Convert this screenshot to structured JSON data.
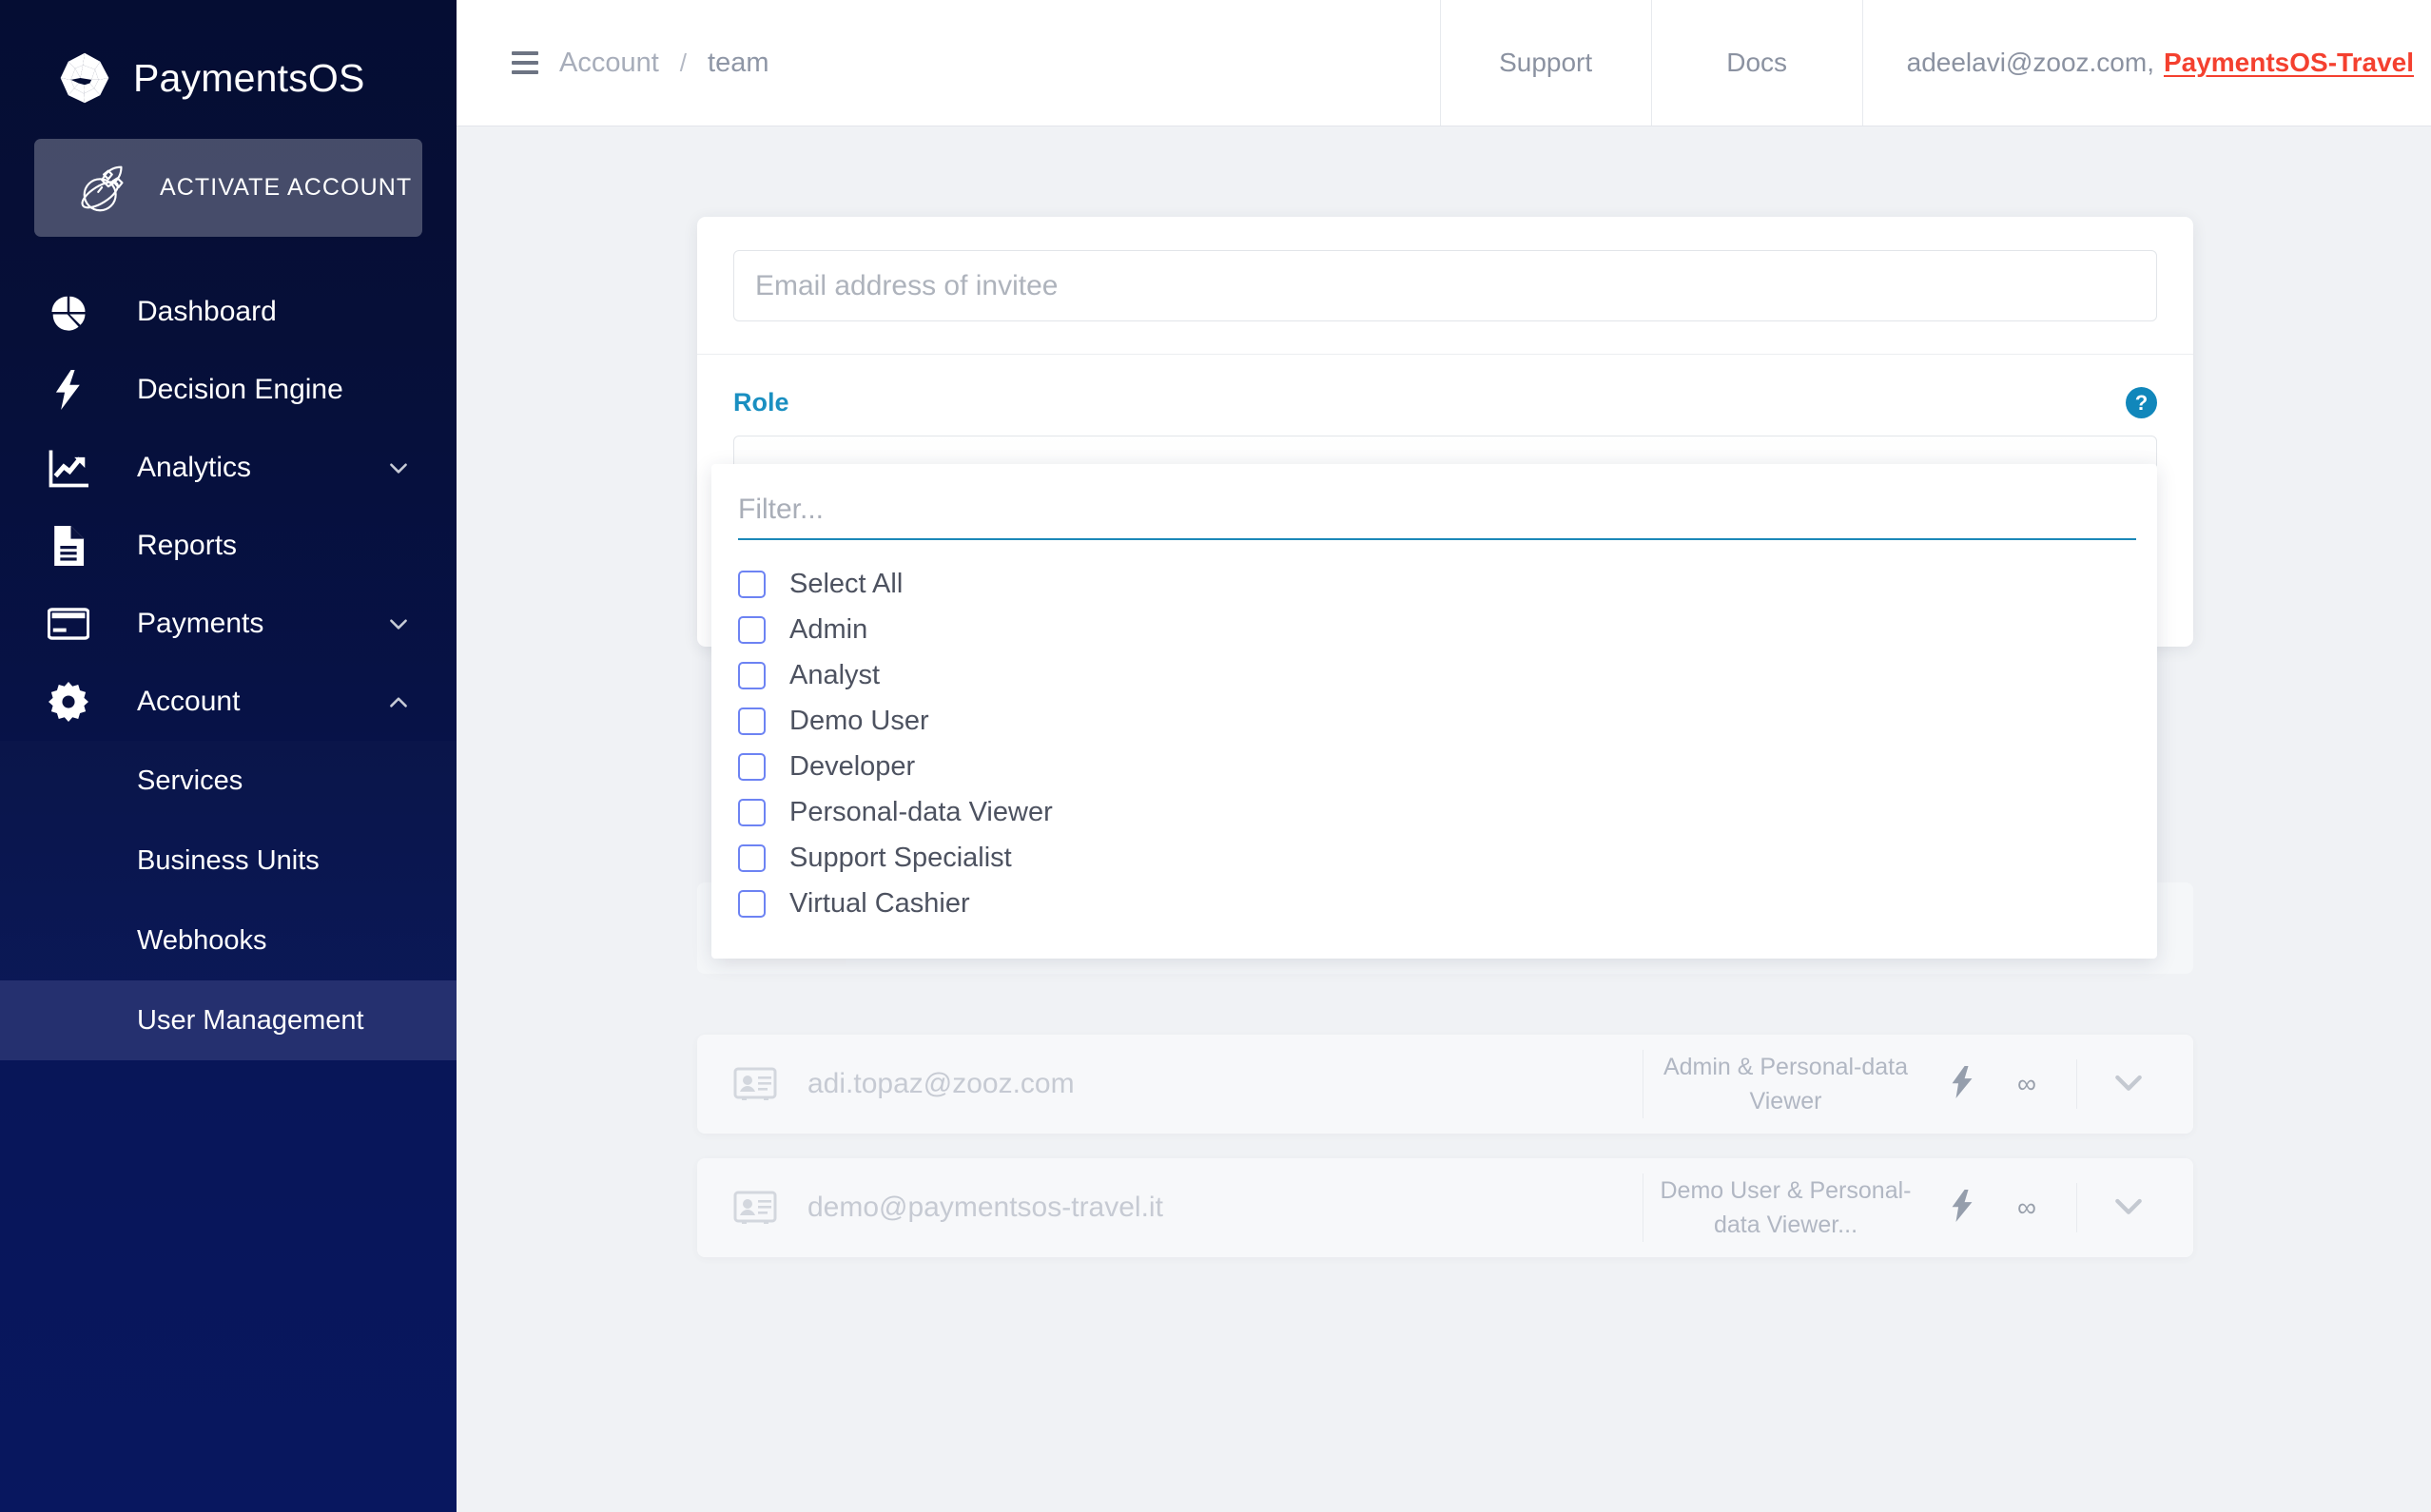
{
  "sidebar": {
    "brand": {
      "name": "PaymentsOS",
      "logo_icon": "paymentsos-polygon-logo"
    },
    "activate": {
      "label": "ACTIVATE ACCOUNT",
      "icon": "rocket-planet-icon"
    },
    "items": [
      {
        "label": "Dashboard",
        "icon": "pie-chart-icon",
        "chevron": ""
      },
      {
        "label": "Decision Engine",
        "icon": "lightning-bolt-icon",
        "chevron": ""
      },
      {
        "label": "Analytics",
        "icon": "trend-chart-icon",
        "chevron": "down"
      },
      {
        "label": "Reports",
        "icon": "document-icon",
        "chevron": ""
      },
      {
        "label": "Payments",
        "icon": "credit-card-icon",
        "chevron": "down"
      },
      {
        "label": "Account",
        "icon": "gear-icon",
        "chevron": "up"
      }
    ],
    "sub_items": [
      {
        "label": "Services",
        "active": false
      },
      {
        "label": "Business Units",
        "active": false
      },
      {
        "label": "Webhooks",
        "active": false
      },
      {
        "label": "User Management",
        "active": true
      }
    ]
  },
  "header": {
    "menu_icon": "hamburger-icon",
    "breadcrumb": {
      "parent": "Account",
      "separator": "/",
      "current": "team"
    },
    "support_label": "Support",
    "docs_label": "Docs",
    "user_email": "adeelavi@zooz.com,",
    "organization": "PaymentsOS-Travel",
    "organization_color": "#f4402f"
  },
  "invite_form": {
    "email_placeholder": "Email address of invitee",
    "email_value": "",
    "role_label": "Role",
    "help_icon": "question-mark-icon",
    "help_glyph": "?",
    "role_value": "",
    "accent_color": "#1a8fc1"
  },
  "role_dropdown": {
    "filter_placeholder": "Filter...",
    "filter_value": "",
    "underline_color": "#1b87b8",
    "checkbox_color": "#6d83f3",
    "options": [
      {
        "label": "Select All",
        "checked": false
      },
      {
        "label": "Admin",
        "checked": false
      },
      {
        "label": "Analyst",
        "checked": false
      },
      {
        "label": "Demo User",
        "checked": false
      },
      {
        "label": "Developer",
        "checked": false
      },
      {
        "label": "Personal-data Viewer",
        "checked": false
      },
      {
        "label": "Support Specialist",
        "checked": false
      },
      {
        "label": "Virtual Cashier",
        "checked": false
      }
    ]
  },
  "search_row": {
    "icon": "search-icon",
    "value": ""
  },
  "user_rows": [
    {
      "avatar_icon": "id-card-icon",
      "email": "adi.topaz@zooz.com",
      "roles": "Admin & Personal-data Viewer",
      "bolt_icon": "lightning-bolt-icon",
      "infinity_glyph": "∞",
      "chevron_icon": "chevron-down-icon"
    },
    {
      "avatar_icon": "id-card-icon",
      "email": "demo@paymentsos-travel.it",
      "roles": "Demo User & Personal-data Viewer...",
      "bolt_icon": "lightning-bolt-icon",
      "infinity_glyph": "∞",
      "chevron_icon": "chevron-down-icon"
    }
  ]
}
